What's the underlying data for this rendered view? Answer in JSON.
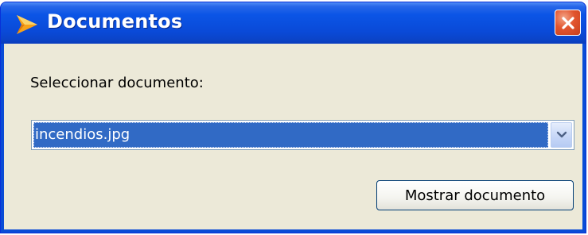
{
  "window": {
    "title": "Documentos",
    "icon": "app-arrow-icon",
    "close_icon": "close-icon"
  },
  "form": {
    "label": "Seleccionar documento:",
    "select_value": "incendios.jpg",
    "dropdown_icon": "chevron-down-icon",
    "show_button_label": "Mostrar documento"
  },
  "colors": {
    "titlebar": "#0a4cd6",
    "client_bg": "#ece9d8",
    "selection": "#316ac5",
    "close_button": "#e2552f"
  }
}
